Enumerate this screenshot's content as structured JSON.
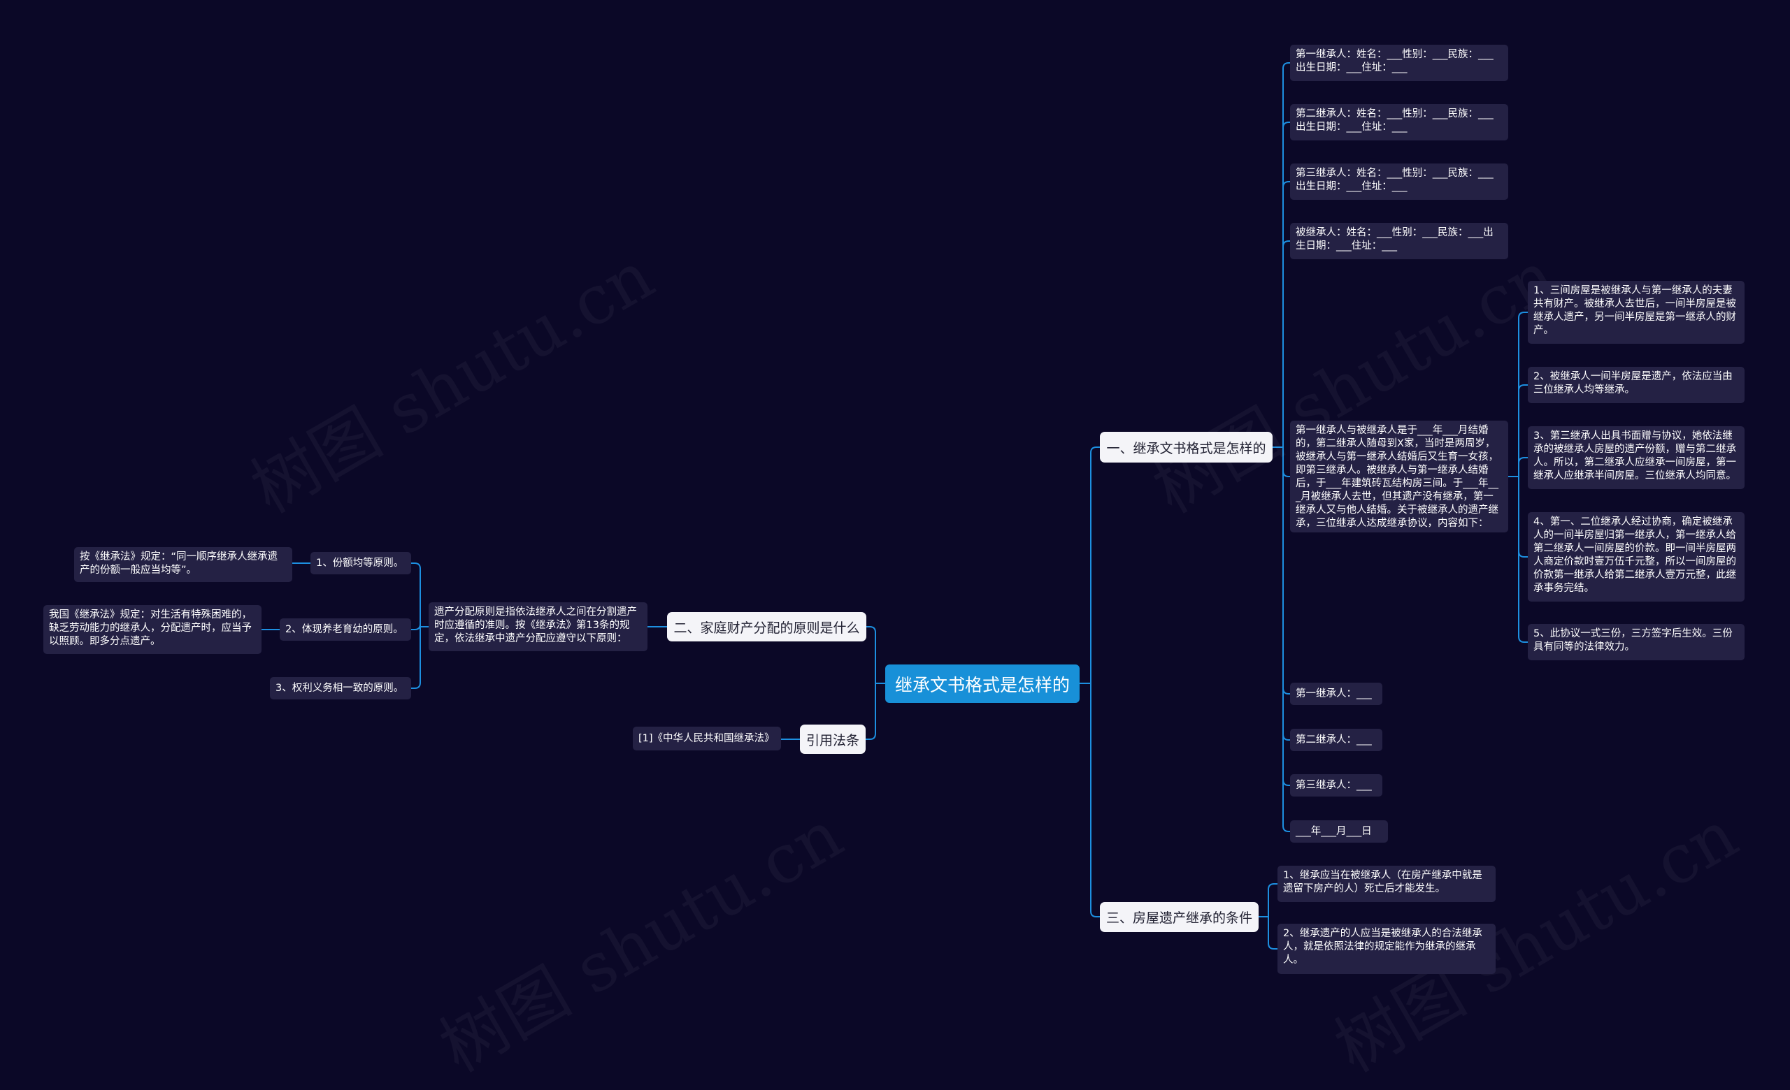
{
  "watermark": "树图 shutu.cn",
  "colors": {
    "background": "#0b0827",
    "line": "#1d8fe0",
    "central": "#1890d8",
    "branch": "#f4f4f8",
    "leaf": "#242144"
  },
  "central": "继承文书格式是怎样的",
  "branches": {
    "b1": "一、继承文书格式是怎样的",
    "b2": "二、家庭财产分配的原则是什么",
    "b3": "三、房屋遗产继承的条件",
    "b4": "引用法条"
  },
  "b1_items": {
    "heir1": "第一继承人：姓名：___性别：___民族：___出生日期：___住址：___",
    "heir2": "第二继承人：姓名：___性别：___民族：___出生日期：___住址：___",
    "heir3": "第三继承人：姓名：___性别：___民族：___出生日期：___住址：___",
    "decedent": "被继承人：姓名：___性别：___民族：___出生日期：___住址：___",
    "story": "第一继承人与被继承人是于___年___月结婚的，第二继承人随母到X家，当时是两周岁，被继承人与第一继承人结婚后又生育一女孩，即第三继承人。被继承人与第一继承人结婚后，于___年建筑砖瓦结构房三间。于___年___月被继承人去世，但其遗产没有继承，第一继承人又与他人结婚。关于被继承人的遗产继承，三位继承人达成继承协议，内容如下：",
    "agreement": [
      "1、三间房屋是被继承人与第一继承人的夫妻共有财产。被继承人去世后，一间半房屋是被继承人遗产，另一间半房屋是第一继承人的财产。",
      "2、被继承人一间半房屋是遗产，依法应当由三位继承人均等继承。",
      "3、第三继承人出具书面赠与协议，她依法继承的被继承人房屋的遗产份额，赠与第二继承人。所以，第二继承人应继承一间房屋，第一继承人应继承半间房屋。三位继承人均同意。",
      "4、第一、二位继承人经过协商，确定被继承人的一间半房屋归第一继承人，第一继承人给第二继承人一间房屋的价款。即一间半房屋两人商定价款时壹万伍千元整，所以一间房屋的价款第一继承人给第二继承人壹万元整，此继承事务完结。",
      "5、此协议一式三份，三方签字后生效。三份具有同等的法律效力。"
    ],
    "sign1": "第一继承人：___",
    "sign2": "第二继承人：___",
    "sign3": "第三继承人：___",
    "date": "___年___月___日"
  },
  "b2_items": {
    "intro": "遗产分配原则是指依法继承人之间在分割遗产时应遵循的准则。按《继承法》第13条的规定，依法继承中遗产分配应遵守以下原则：",
    "p1": "1、份额均等原则。",
    "p1_note": "按《继承法》规定：“同一顺序继承人继承遗产的份额一般应当均等”。",
    "p2": "2、体现养老育幼的原则。",
    "p2_note": "我国《继承法》规定：对生活有特殊困难的，缺乏劳动能力的继承人，分配遗产时，应当予以照顾。即多分点遗产。",
    "p3": "3、权利义务相一致的原则。"
  },
  "b3_items": {
    "c1": "1、继承应当在被继承人（在房产继承中就是遗留下房产的人）死亡后才能发生。",
    "c2": "2、继承遗产的人应当是被继承人的合法继承人，就是依照法律的规定能作为继承的继承人。"
  },
  "b4_items": {
    "law": "[1]《中华人民共和国继承法》"
  }
}
